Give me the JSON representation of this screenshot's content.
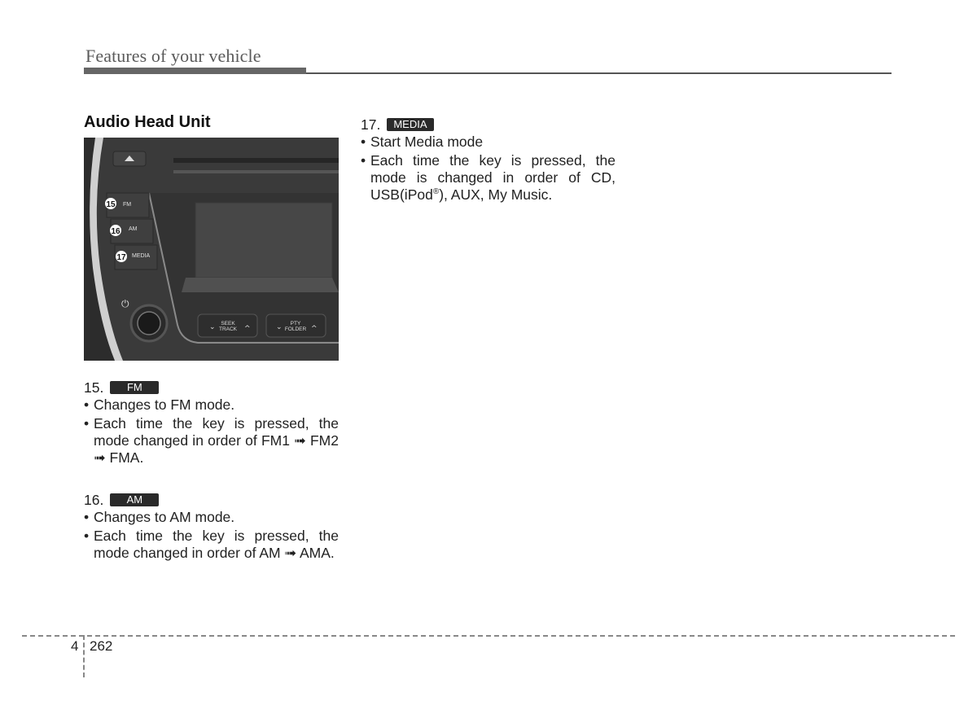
{
  "header": {
    "title": "Features of your vehicle"
  },
  "section": {
    "title": "Audio Head Unit"
  },
  "photo": {
    "labels": {
      "fm": "FM",
      "am": "AM",
      "media": "MEDIA",
      "seek_track_top": "SEEK",
      "seek_track_bottom": "TRACK",
      "pty_folder_top": "PTY",
      "pty_folder_bottom": "FOLDER"
    },
    "callouts": [
      "15",
      "16",
      "17"
    ]
  },
  "items": [
    {
      "number": "15.",
      "badge": "FM",
      "bullets": [
        "Changes to FM mode.",
        "Each time the key is pressed, the mode changed in order of FM1 ➟ FM2 ➟ FMA."
      ]
    },
    {
      "number": "16.",
      "badge": "AM",
      "bullets": [
        "Changes to AM mode.",
        "Each time the key is pressed, the mode changed in order of AM ➟ AMA."
      ]
    },
    {
      "number": "17.",
      "badge": "MEDIA",
      "bullets": [
        "Start Media mode",
        "Each time the key is pressed, the mode is changed in order of CD, USB(iPod",
        "), AUX, My Music."
      ],
      "registered_mark": "®"
    }
  ],
  "footer": {
    "chapter": "4",
    "page": "262"
  }
}
